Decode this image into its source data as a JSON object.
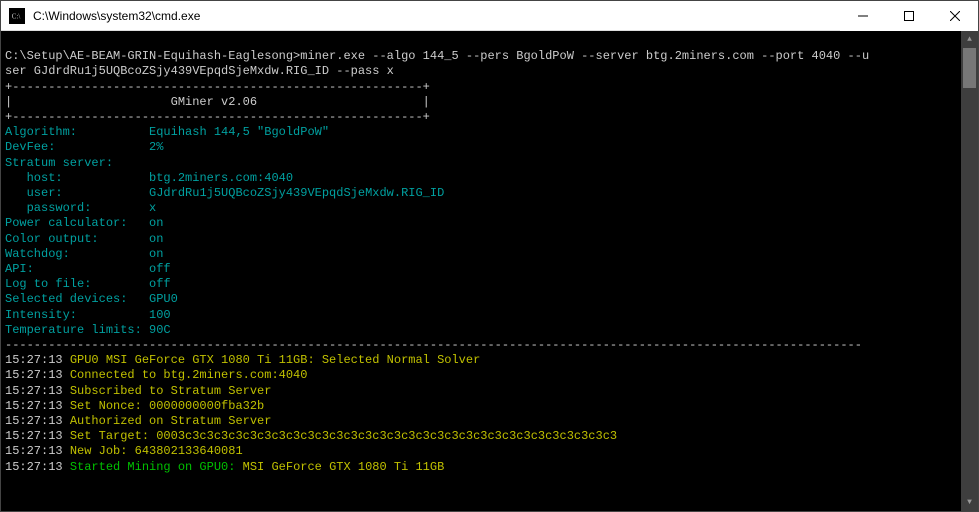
{
  "window": {
    "title": "C:\\Windows\\system32\\cmd.exe"
  },
  "terminal": {
    "prompt_line1": "C:\\Setup\\AE-BEAM-GRIN-Equihash-Eaglesong>miner.exe --algo 144_5 --pers BgoldPoW --server btg.2miners.com --port 4040 --u",
    "prompt_line2": "ser GJdrdRu1j5UQBcoZSjy439VEpqdSjeMxdw.RIG_ID --pass x",
    "box_top": "+---------------------------------------------------------+",
    "box_mid": "|                      GMiner v2.06                       |",
    "box_bot": "+---------------------------------------------------------+",
    "config_labels": {
      "algorithm": "Algorithm:",
      "devfee": "DevFee:",
      "stratum": "Stratum server:",
      "host": "   host:",
      "user": "   user:",
      "password": "   password:",
      "power": "Power calculator:",
      "color": "Color output:",
      "watchdog": "Watchdog:",
      "api": "API:",
      "logfile": "Log to file:",
      "devices": "Selected devices:",
      "intensity": "Intensity:",
      "temp": "Temperature limits:"
    },
    "config_values": {
      "algorithm": "Equihash 144,5 \"BgoldPoW\"",
      "devfee": "2%",
      "host": "btg.2miners.com:4040",
      "user": "GJdrdRu1j5UQBcoZSjy439VEpqdSjeMxdw.RIG_ID",
      "password": "x",
      "power": "on",
      "color": "on",
      "watchdog": "on",
      "api": "off",
      "logfile": "off",
      "devices": "GPU0",
      "intensity": "100",
      "temp": "90C"
    },
    "sep": "-----------------------------------------------------------------------------------------------------------------------",
    "log": [
      {
        "ts": "15:27:13",
        "msg": "GPU0 MSI GeForce GTX 1080 Ti 11GB: Selected Normal Solver",
        "color": "yellow"
      },
      {
        "ts": "15:27:13",
        "msg": "Connected to btg.2miners.com:4040",
        "color": "yellow"
      },
      {
        "ts": "15:27:13",
        "msg": "Subscribed to Stratum Server",
        "color": "yellow"
      },
      {
        "ts": "15:27:13",
        "msg": "Set Nonce: 0000000000fba32b",
        "color": "yellow"
      },
      {
        "ts": "15:27:13",
        "msg": "Authorized on Stratum Server",
        "color": "yellow"
      },
      {
        "ts": "15:27:13",
        "msg": "Set Target: 0003c3c3c3c3c3c3c3c3c3c3c3c3c3c3c3c3c3c3c3c3c3c3c3c3c3c3c3c3c3c3",
        "color": "yellow"
      },
      {
        "ts": "15:27:13",
        "msg": "New Job: 643802133640081",
        "color": "yellow"
      }
    ],
    "log_final": {
      "ts": "15:27:13",
      "prefix": "Started Mining on GPU0:",
      "suffix": " MSI GeForce GTX 1080 Ti 11GB"
    }
  }
}
